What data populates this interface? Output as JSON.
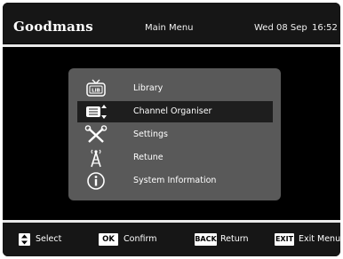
{
  "header": {
    "brand": "Goodmans",
    "title": "Main Menu",
    "date": "Wed 08 Sep",
    "time": "16:52"
  },
  "menu": {
    "items": [
      {
        "label": "Library",
        "icon": "tv-library-icon",
        "selected": false
      },
      {
        "label": "Channel Organiser",
        "icon": "channel-list-icon",
        "selected": true
      },
      {
        "label": "Settings",
        "icon": "tools-icon",
        "selected": false
      },
      {
        "label": "Retune",
        "icon": "antenna-icon",
        "selected": false
      },
      {
        "label": "System Information",
        "icon": "info-icon",
        "selected": false
      }
    ]
  },
  "footer": {
    "select_label": "Select",
    "ok_key": "OK",
    "confirm_label": "Confirm",
    "back_key": "BACK",
    "return_label": "Return",
    "exit_key": "EXIT",
    "exit_label": "Exit Menu"
  },
  "colors": {
    "background": "#000000",
    "panel": "#595959",
    "selected_row": "#1e1e1e",
    "rule": "#e9e9e9"
  }
}
